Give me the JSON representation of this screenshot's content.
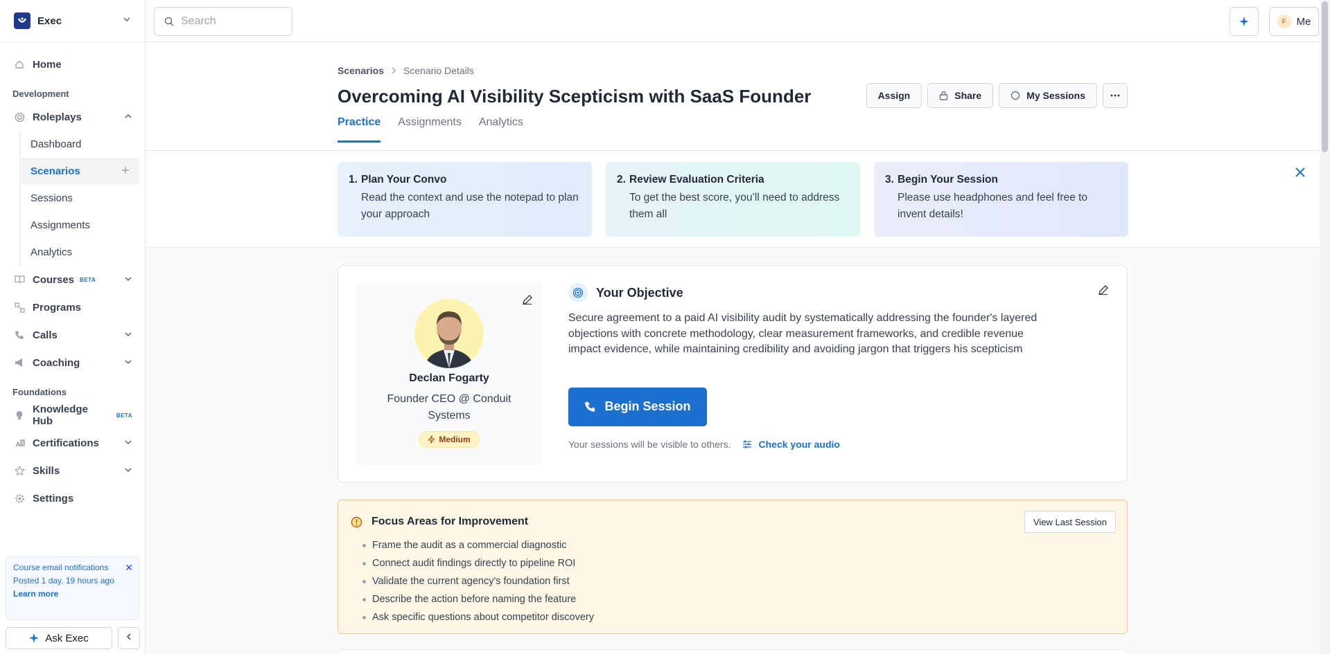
{
  "workspace": {
    "name": "Exec"
  },
  "sidebar": {
    "home": "Home",
    "sections": {
      "development": "Development",
      "foundations": "Foundations"
    },
    "roleplays": "Roleplays",
    "roleplays_sub": [
      "Dashboard",
      "Scenarios",
      "Sessions",
      "Assignments",
      "Analytics"
    ],
    "courses": "Courses",
    "beta": "BETA",
    "programs": "Programs",
    "calls": "Calls",
    "coaching": "Coaching",
    "knowledge_hub": "Knowledge Hub",
    "certifications": "Certifications",
    "skills": "Skills",
    "settings": "Settings",
    "notice": {
      "title": "Course email notifications",
      "posted": "Posted 1 day, 19 hours ago",
      "link": "Learn more"
    },
    "ask": "Ask Exec"
  },
  "topbar": {
    "search_placeholder": "Search",
    "avatar_initial": "F",
    "me": "Me"
  },
  "breadcrumb": {
    "parent": "Scenarios",
    "current": "Scenario Details"
  },
  "page_title": "Overcoming AI Visibility Scepticism with SaaS Founder",
  "actions": {
    "assign": "Assign",
    "share": "Share",
    "my_sessions": "My Sessions"
  },
  "tabs": [
    "Practice",
    "Assignments",
    "Analytics"
  ],
  "steps": [
    {
      "num": "1.",
      "title": "Plan Your Convo",
      "desc": "Read the context and use the notepad to plan your approach"
    },
    {
      "num": "2.",
      "title": "Review Evaluation Criteria",
      "desc": "To get the best score, you’ll need to address them all"
    },
    {
      "num": "3.",
      "title": "Begin Your Session",
      "desc": "Please use headphones and feel free to invent details!"
    }
  ],
  "persona": {
    "name": "Declan Fogarty",
    "role": "Founder CEO @ Conduit Systems",
    "difficulty": "Medium"
  },
  "objective": {
    "heading": "Your Objective",
    "text": "Secure agreement to a paid AI visibility audit by systematically addressing the founder's layered objections with concrete methodology, clear measurement frameworks, and credible revenue impact evidence, while maintaining credibility and avoiding jargon that triggers his scepticism",
    "begin": "Begin Session",
    "visibility_note": "Your sessions will be visible to others.",
    "check_audio": "Check your audio"
  },
  "focus": {
    "heading": "Focus Areas for Improvement",
    "view_last": "View Last Session",
    "items": [
      "Frame the audit as a commercial diagnostic",
      "Connect audit findings directly to pipeline ROI",
      "Validate the current agency's foundation first",
      "Describe the action before naming the feature",
      "Ask specific questions about competitor discovery"
    ]
  },
  "colors": {
    "accent": "#1d6fcf",
    "brand": "#1e3a8a",
    "focus_bg": "#fef7e6",
    "focus_border": "#f7c985"
  }
}
